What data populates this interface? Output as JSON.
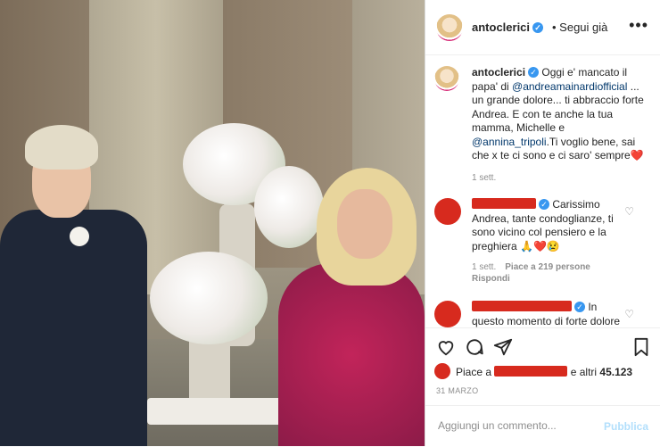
{
  "post": {
    "username": "antoclerici",
    "follow_label": "• Segui già",
    "more_icon": "more-horizontal-icon",
    "caption": {
      "username": "antoclerici",
      "text_1": "Oggi e' mancato il papa' di",
      "mention_1": "@andreamainardiofficial",
      "text_2": "... un grande dolore... ti abbraccio forte Andrea. E con te anche la tua mamma, Michelle e",
      "mention_2": "@annina_tripoli",
      "text_3": ".Ti voglio bene, sai che x te ci sono e ci saro' sempre",
      "emoji": "❤️",
      "time": "1 sett."
    },
    "comments": [
      {
        "text": "Carissimo Andrea, tante condoglianze, ti sono vicino col pensiero e la preghiera",
        "emoji": "🙏❤️😢",
        "time": "1 sett.",
        "likes": "Piace a 219 persone",
        "reply": "Rispondi"
      },
      {
        "text": "In questo momento di forte dolore"
      }
    ],
    "likes_prefix": "Piace a",
    "likes_suffix": "e altri",
    "likes_count": "45.123",
    "date": "31 MARZO",
    "comment_placeholder": "Aggiungi un commento...",
    "publish_label": "Pubblica"
  },
  "colors": {
    "link": "#00376b",
    "verified": "#3897f0",
    "publish_disabled": "#b2dffc",
    "redaction": "#d72a1e"
  }
}
